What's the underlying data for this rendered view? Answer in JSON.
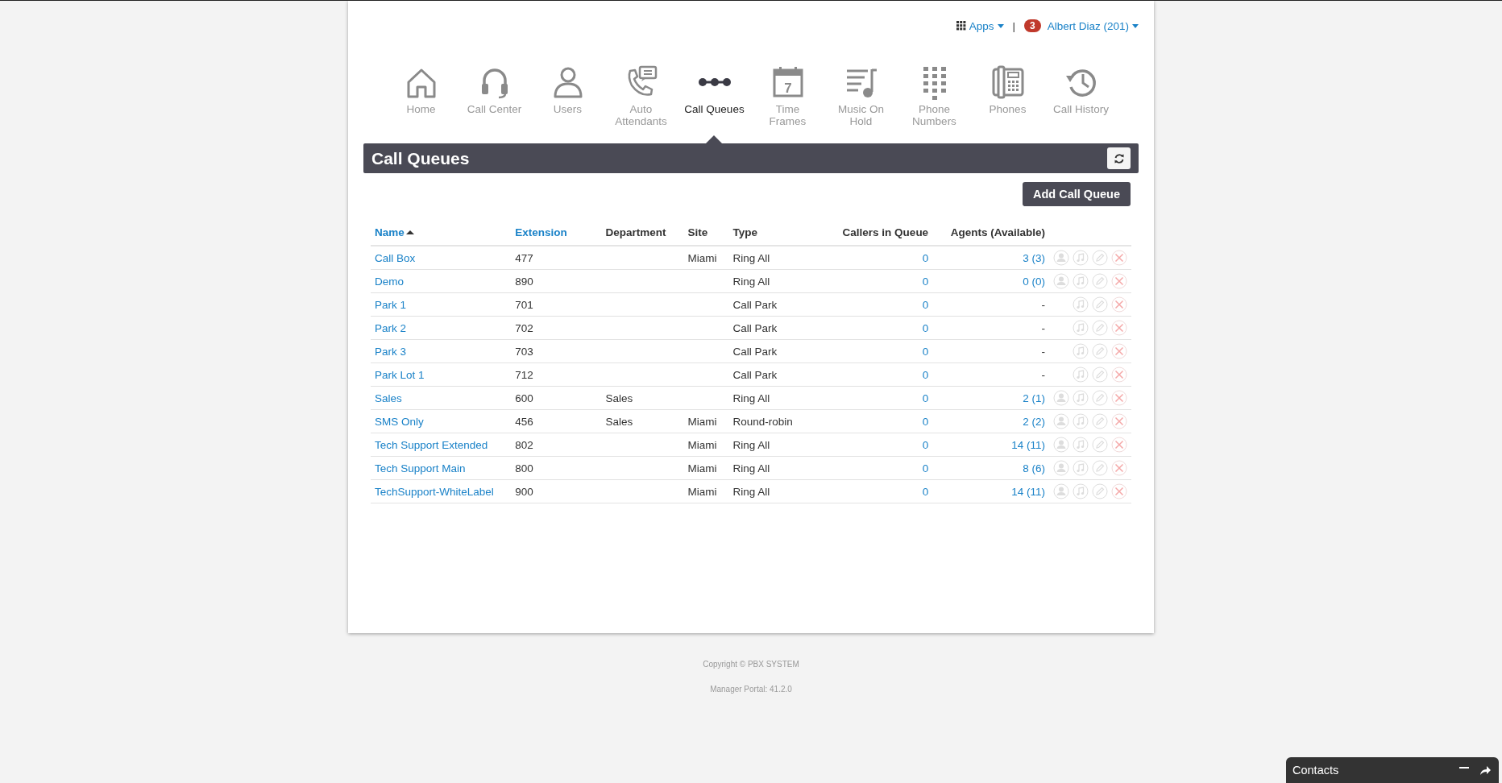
{
  "topbar": {
    "apps_label": "Apps",
    "separator": "|",
    "notification_count": "3",
    "user_label": "Albert Diaz (201)"
  },
  "nav": [
    {
      "kind": "home",
      "label": "Home",
      "selected": false
    },
    {
      "kind": "headset",
      "label": "Call Center",
      "selected": false
    },
    {
      "kind": "user",
      "label": "Users",
      "selected": false
    },
    {
      "kind": "attendant",
      "label": "Auto Attendants",
      "selected": false
    },
    {
      "kind": "queue",
      "label": "Call Queues",
      "selected": true
    },
    {
      "kind": "calendar",
      "label": "Time Frames",
      "selected": false,
      "icon_text": "7"
    },
    {
      "kind": "music",
      "label": "Music On Hold",
      "selected": false
    },
    {
      "kind": "dialpad",
      "label": "Phone Numbers",
      "selected": false
    },
    {
      "kind": "phone",
      "label": "Phones",
      "selected": false
    },
    {
      "kind": "history",
      "label": "Call History",
      "selected": false
    }
  ],
  "panel": {
    "title": "Call Queues",
    "add_button": "Add Call Queue"
  },
  "table": {
    "columns": [
      {
        "label": "Name",
        "sortable": true,
        "sorted": true
      },
      {
        "label": "Extension",
        "sortable": true,
        "sorted": false
      },
      {
        "label": "Department",
        "sortable": false,
        "sorted": false
      },
      {
        "label": "Site",
        "sortable": false,
        "sorted": false
      },
      {
        "label": "Type",
        "sortable": false,
        "sorted": false
      },
      {
        "label": "Callers in Queue",
        "sortable": false,
        "sorted": false
      },
      {
        "label": "Agents (Available)",
        "sortable": false,
        "sorted": false
      }
    ],
    "rows": [
      {
        "name": "Call Box",
        "extension": "477",
        "department": "",
        "site": "Miami",
        "type": "Ring All",
        "callers": "0",
        "agents": "3 (3)",
        "agents_button": true
      },
      {
        "name": "Demo",
        "extension": "890",
        "department": "",
        "site": "",
        "type": "Ring All",
        "callers": "0",
        "agents": "0 (0)",
        "agents_button": true
      },
      {
        "name": "Park 1",
        "extension": "701",
        "department": "",
        "site": "",
        "type": "Call Park",
        "callers": "0",
        "agents": "-",
        "agents_button": false
      },
      {
        "name": "Park 2",
        "extension": "702",
        "department": "",
        "site": "",
        "type": "Call Park",
        "callers": "0",
        "agents": "-",
        "agents_button": false
      },
      {
        "name": "Park 3",
        "extension": "703",
        "department": "",
        "site": "",
        "type": "Call Park",
        "callers": "0",
        "agents": "-",
        "agents_button": false
      },
      {
        "name": "Park Lot 1",
        "extension": "712",
        "department": "",
        "site": "",
        "type": "Call Park",
        "callers": "0",
        "agents": "-",
        "agents_button": false
      },
      {
        "name": "Sales",
        "extension": "600",
        "department": "Sales",
        "site": "",
        "type": "Ring All",
        "callers": "0",
        "agents": "2 (1)",
        "agents_button": true
      },
      {
        "name": "SMS Only",
        "extension": "456",
        "department": "Sales",
        "site": "Miami",
        "type": "Round-robin",
        "callers": "0",
        "agents": "2 (2)",
        "agents_button": true
      },
      {
        "name": "Tech Support Extended",
        "extension": "802",
        "department": "",
        "site": "Miami",
        "type": "Ring All",
        "callers": "0",
        "agents": "14 (11)",
        "agents_button": true
      },
      {
        "name": "Tech Support Main",
        "extension": "800",
        "department": "",
        "site": "Miami",
        "type": "Ring All",
        "callers": "0",
        "agents": "8 (6)",
        "agents_button": true
      },
      {
        "name": "TechSupport-WhiteLabel",
        "extension": "900",
        "department": "",
        "site": "Miami",
        "type": "Ring All",
        "callers": "0",
        "agents": "14 (11)",
        "agents_button": true
      }
    ]
  },
  "footer": {
    "copyright": "Copyright © PBX SYSTEM",
    "version": "Manager Portal: 41.2.0"
  },
  "contacts": {
    "title": "Contacts"
  }
}
